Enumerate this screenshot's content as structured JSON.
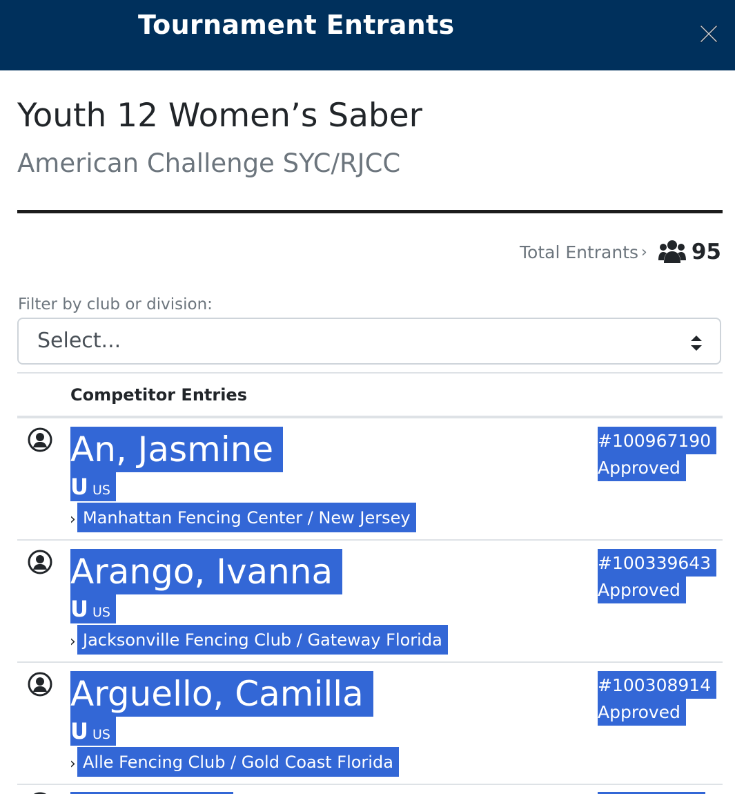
{
  "modal": {
    "title": "Tournament Entrants",
    "close_icon": "close-icon"
  },
  "event": {
    "title": "Youth 12 Women’s Saber",
    "subtitle": "American Challenge SYC/RJCC"
  },
  "total": {
    "label": "Total Entrants",
    "chevron": "›",
    "icon": "users-icon",
    "count": "95"
  },
  "filter": {
    "label": "Filter by club or division:",
    "value": "Select..."
  },
  "table": {
    "header": "Competitor Entries",
    "entries": [
      {
        "name": "An, Jasmine",
        "membership": "U",
        "country": "US",
        "chevron": "›",
        "club": "Manhattan Fencing Center / New Jersey",
        "member_id": "#100967190",
        "status": "Approved"
      },
      {
        "name": "Arango, Ivanna",
        "membership": "U",
        "country": "US",
        "chevron": "›",
        "club": "Jacksonville Fencing Club / Gateway Florida",
        "member_id": "#100339643",
        "status": "Approved"
      },
      {
        "name": "Arguello, Camilla",
        "membership": "U",
        "country": "US",
        "chevron": "›",
        "club": "Alle Fencing Club / Gold Coast Florida",
        "member_id": "#100308914",
        "status": "Approved"
      }
    ]
  },
  "colors": {
    "header_bg": "#00305c",
    "selection_highlight": "#3367d6",
    "muted_text": "#6c757d"
  }
}
